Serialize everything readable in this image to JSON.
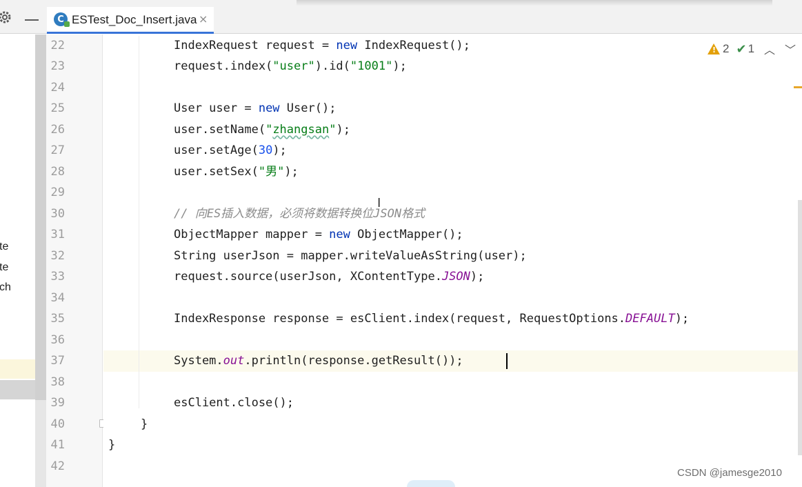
{
  "tab": {
    "title": "ESTest_Doc_Insert.java",
    "icon": "java-class-icon",
    "close": "×"
  },
  "sidebar": {
    "items": [
      "te",
      "te",
      "ch"
    ]
  },
  "inspections": {
    "warnings": "2",
    "typos": "1"
  },
  "lines": [
    "22",
    "23",
    "24",
    "25",
    "26",
    "27",
    "28",
    "29",
    "30",
    "31",
    "32",
    "33",
    "34",
    "35",
    "36",
    "37",
    "38",
    "39",
    "40",
    "41",
    "42"
  ],
  "code": {
    "l22": {
      "a": "IndexRequest request = ",
      "kw": "new",
      "b": " IndexRequest();"
    },
    "l23": {
      "a": "request.index(",
      "s1": "\"user\"",
      "b": ").id(",
      "s2": "\"1001\"",
      "c": ");"
    },
    "l25": {
      "a": "User user = ",
      "kw": "new",
      "b": " User();"
    },
    "l26": {
      "a": "user.setName(",
      "s1": "\"",
      "typo": "zhangsan",
      "s2": "\"",
      "b": ");"
    },
    "l27": {
      "a": "user.setAge(",
      "n": "30",
      "b": ");"
    },
    "l28": {
      "a": "user.setSex(",
      "s": "\"男\"",
      "b": ");"
    },
    "l30": "// 向ES插入数据，必须将数据转换位JSON格式",
    "l31": {
      "a": "ObjectMapper mapper = ",
      "kw": "new",
      "b": " ObjectMapper();"
    },
    "l32": "String userJson = mapper.writeValueAsString(user);",
    "l33": {
      "a": "request.source(userJson, XContentType.",
      "st": "JSON",
      "b": ");"
    },
    "l35": {
      "a": "IndexResponse response = esClient.index(request, RequestOptions.",
      "st": "DEFAULT",
      "b": ");"
    },
    "l37": {
      "a": "System.",
      "st": "out",
      "b": ".println(response.getResult());"
    },
    "l39": "esClient.close();",
    "l40": "}",
    "l41": "}"
  },
  "watermark": "CSDN @jamesge2010",
  "colors": {
    "keyword": "#0033b3",
    "string": "#067d17",
    "number": "#1750eb",
    "comment": "#8c8c8c",
    "static": "#871094",
    "tab_underline": "#3874d8",
    "warning": "#e3a008"
  }
}
